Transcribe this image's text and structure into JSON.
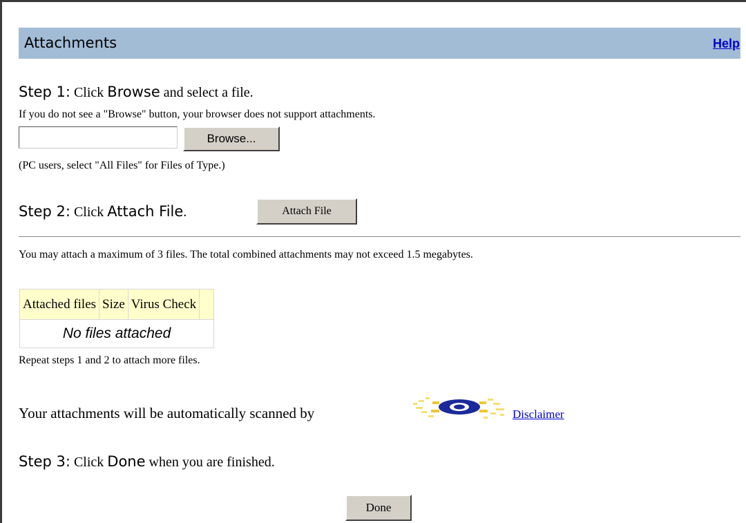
{
  "header": {
    "title": "Attachments",
    "help_label": "Help"
  },
  "step1": {
    "label": "Step 1:",
    "text_before": " Click ",
    "keyword": "Browse",
    "text_after": " and select a file.",
    "note": "If you do not see a \"Browse\" button, your browser does not support attachments.",
    "file_input_value": "",
    "browse_label": "Browse...",
    "hint": "(PC users, select \"All Files\" for Files of Type.)"
  },
  "step2": {
    "label": "Step 2:",
    "text_before": " Click ",
    "keyword": "Attach File",
    "text_after": ".",
    "button_label": "Attach File"
  },
  "limits_text": "You may attach a maximum of 3 files. The total combined attachments may not exceed 1.5 megabytes.",
  "attachments_table": {
    "columns": [
      "Attached files",
      "Size",
      "Virus Check",
      ""
    ],
    "empty_message": "No files attached"
  },
  "repeat_text": "Repeat steps 1 and 2 to attach more files.",
  "scan": {
    "text": "Your attachments will be automatically scanned by",
    "logo_icon": "virus-scanner-logo-icon",
    "disclaimer_label": "Disclaimer"
  },
  "step3": {
    "label": "Step 3:",
    "text_before": " Click ",
    "keyword": "Done",
    "text_after": " when you are finished.",
    "button_label": "Done"
  },
  "colors": {
    "header_bg": "#a3bcd6",
    "table_header_bg": "#ffffcc",
    "link": "#0000cc",
    "button_face": "#d4d0c8"
  }
}
